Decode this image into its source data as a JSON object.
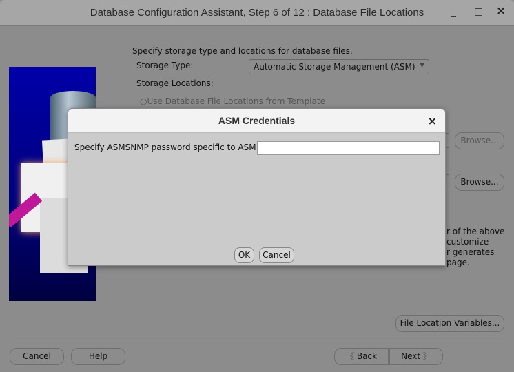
{
  "window": {
    "title": "Database Configuration Assistant, Step 6 of 12 : Database File Locations",
    "minimize": "_",
    "maximize": "□",
    "close": "×"
  },
  "main": {
    "intro": "Specify storage type and locations for database files.",
    "storage_type_label": "Storage Type:",
    "storage_type_value": "Automatic Storage Management (ASM)",
    "storage_locations_label": "Storage Locations:",
    "radio_template": "Use Database File Locations from Template",
    "browse1": "Browse...",
    "browse2": "Browse...",
    "partial_text": [
      "r of the above",
      "customize",
      "r generates",
      "page."
    ],
    "file_location_variables": "File Location Variables..."
  },
  "footer": {
    "cancel": "Cancel",
    "help": "Help",
    "back": "Back",
    "next": "Next"
  },
  "dialog": {
    "title": "ASM Credentials",
    "close": "×",
    "password_label": "Specify ASMSNMP password specific to ASM:",
    "password_value": "",
    "ok": "OK",
    "cancel": "Cancel"
  }
}
